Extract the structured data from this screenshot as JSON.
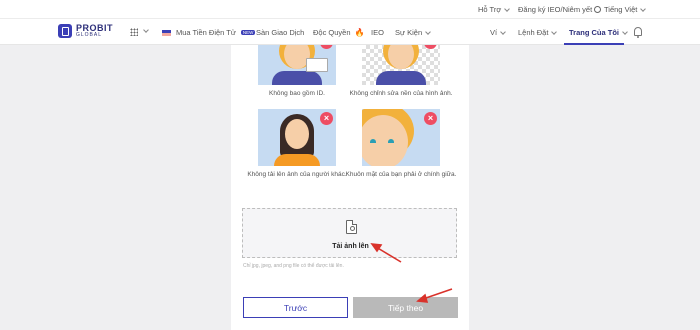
{
  "topbar": {
    "support": "Hỗ Trợ",
    "ieo_register": "Đăng ký IEO/Niêm yết",
    "language": "Tiếng Việt"
  },
  "navbar": {
    "logo_main": "PROBIT",
    "logo_sub": "GLOBAL",
    "buy_crypto": "Mua Tiền Điện Tử",
    "buy_badge": "NEW",
    "exchange": "Sàn Giao Dịch",
    "exclusive": "Độc Quyền",
    "ieo": "IEO",
    "events": "Sự Kiện",
    "wallet": "Ví",
    "orders": "Lệnh Đặt",
    "my_page": "Trang Của Tôi"
  },
  "examples": [
    {
      "caption": "Không bao gồm ID."
    },
    {
      "caption": "Không chỉnh sửa nền của hình ảnh."
    },
    {
      "caption": "Không tải lên ảnh của người khác."
    },
    {
      "caption": "Khuôn mặt của bạn phải ở chính giữa."
    }
  ],
  "upload": {
    "label": "Tải ảnh lên",
    "hint": "Chỉ jpg, jpeg, and png file có thể được tải lên."
  },
  "buttons": {
    "back": "Trước",
    "next": "Tiếp theo"
  },
  "colors": {
    "brand": "#3b3fb6",
    "error": "#ee4d63",
    "annotation_arrow": "#d9322b",
    "disabled_button": "#b9b9b9"
  }
}
